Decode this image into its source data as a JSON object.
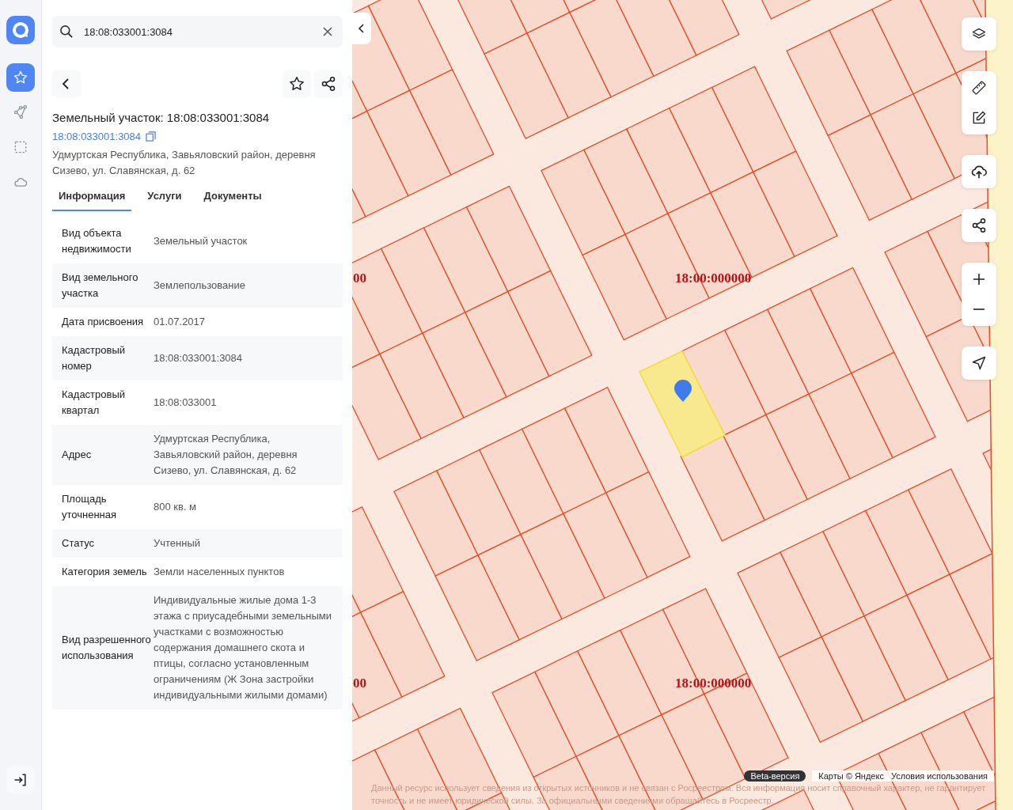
{
  "sidebar": {
    "items": [
      {
        "kind": "favorites",
        "selected": true
      },
      {
        "kind": "route",
        "selected": false
      },
      {
        "kind": "area",
        "selected": false
      },
      {
        "kind": "cloud",
        "selected": false
      }
    ]
  },
  "search": {
    "value": "18:08:033001:3084"
  },
  "object": {
    "title": "Земельный участок: 18:08:033001:3084",
    "number": "18:08:033001:3084",
    "address": "Удмуртская Республика, Завьяловский район, деревня Сизево, ул. Славянская, д. 62"
  },
  "tabs": [
    {
      "label": "Информация",
      "selected": true
    },
    {
      "label": "Услуги",
      "selected": false
    },
    {
      "label": "Документы",
      "selected": false
    }
  ],
  "properties": [
    {
      "name": "Вид объекта недвижимости",
      "value": "Земельный участок"
    },
    {
      "name": "Вид земельного участка",
      "value": "Землепользование"
    },
    {
      "name": "Дата присвоения",
      "value": "01.07.2017"
    },
    {
      "name": "Кадастровый номер",
      "value": "18:08:033001:3084"
    },
    {
      "name": "Кадастровый квартал",
      "value": "18:08:033001"
    },
    {
      "name": "Адрес",
      "value": "Удмуртская Республика, Завьяловский район, деревня Сизево, ул. Славянская, д. 62"
    },
    {
      "name": "Площадь уточненная",
      "value": "800 кв. м"
    },
    {
      "name": "Статус",
      "value": "Учтенный"
    },
    {
      "name": "Категория земель",
      "value": "Земли населенных пунктов"
    },
    {
      "name": "Вид разрешенного использования",
      "value": "Индивидуальные жилые дома 1-3 этажа с приусадебными земельными участками с возможностью содержания домашнего скота и птицы, согласно установленным ограничениям (Ж Зона застройки индивидуальными жилыми домами)"
    }
  ],
  "map": {
    "labels": [
      {
        "text": "00",
        "kind": "cut"
      },
      {
        "text": "18:00:000000",
        "kind": "full"
      },
      {
        "text": "00",
        "kind": "cut"
      },
      {
        "text": "18:00:000000",
        "kind": "full"
      }
    ],
    "badge": "Beta-версия",
    "attribution": "Карты © Яндекс",
    "terms": "Условия использования",
    "disclaimer": "Данный ресурс использует сведения из открытых источников и не связан с Росреестром. Вся информация носит справочный характер, не гарантирует точность и не имеет юридической силы. За официальными сведениями обращайтесь в Росреестр."
  }
}
